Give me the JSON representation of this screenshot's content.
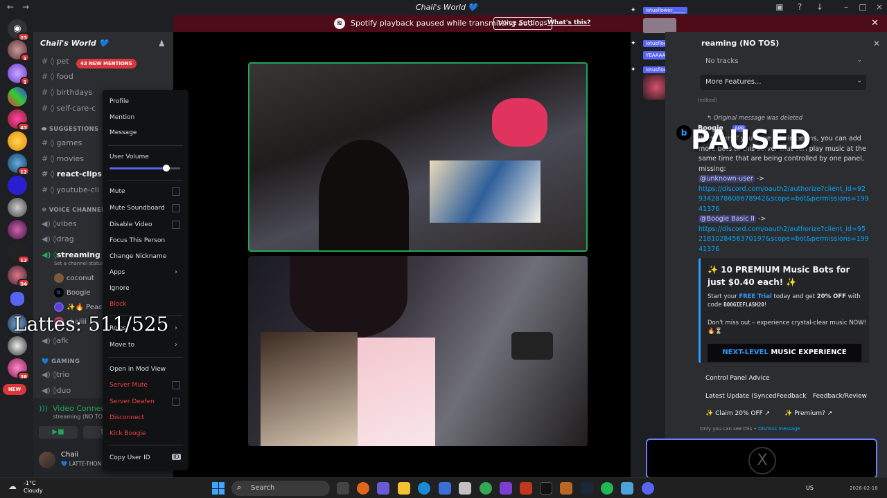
{
  "window": {
    "title": "Chaii's World 💙"
  },
  "banner": {
    "text": "Spotify playback paused while transmitting audio.",
    "button": "Voice Settings",
    "link": "What's this?"
  },
  "rail": {
    "badges": [
      "23",
      "1",
      "1",
      "43",
      "12",
      "12",
      "34",
      "36"
    ],
    "new_label": "NEW"
  },
  "sidebar": {
    "server_name": "Chaii's World 💙",
    "mentions_pill": "43 NEW MENTIONS",
    "channels_top": [
      {
        "name": "pet"
      },
      {
        "name": "food"
      },
      {
        "name": "birthdays"
      },
      {
        "name": "self-care-c"
      }
    ],
    "category_suggestions": "SUGGESTIONS",
    "channels_suggestions": [
      {
        "name": "games"
      },
      {
        "name": "movies"
      },
      {
        "name": "react-clips"
      },
      {
        "name": "youtube-cli"
      }
    ],
    "category_voice": "VOICE CHANNELS",
    "voice_channels": [
      {
        "name": "vibes"
      },
      {
        "name": "drag"
      },
      {
        "name": "streaming ("
      },
      {
        "name": "afk"
      }
    ],
    "streaming_status": "Set a channel status",
    "voice_users": [
      "coconut",
      "Boogie",
      "✨🔥 Peach",
      "chaiiii"
    ],
    "category_gaming": "GAMING",
    "gaming_channels": [
      {
        "name": "trio"
      },
      {
        "name": "duo"
      }
    ],
    "voice_connected": "Video Connected",
    "voice_sub": "streaming (NO TOS) / Chaii",
    "user_name": "Chaii",
    "user_status": "💙 LATTE-THON 💙 [ +1"
  },
  "context_menu": {
    "profile": "Profile",
    "mention": "Mention",
    "message": "Message",
    "user_volume": "User Volume",
    "user_volume_level": 0.8,
    "mute": "Mute",
    "mute_soundboard": "Mute Soundboard",
    "disable_video": "Disable Video",
    "focus": "Focus This Person",
    "change_nickname": "Change Nickname",
    "apps": "Apps",
    "ignore": "Ignore",
    "block": "Block",
    "roles": "Roles",
    "move_to": "Move to",
    "mod_view": "Open in Mod View",
    "server_mute": "Server Mute",
    "server_deafen": "Server Deafen",
    "disconnect": "Disconnect",
    "kick": "Kick Boogie",
    "copy_id": "Copy User ID",
    "id_badge": "ID"
  },
  "overlay": {
    "counter": "Lattes: 511/525",
    "paused": "PAUSED"
  },
  "activity": {
    "users": [
      "lotusflower_____",
      "lotusflower_____",
      "lotusflower_____"
    ],
    "reaction_text": "YEAAAA I LIKE THAT"
  },
  "chat": {
    "panel_title": "reaming (NO TOS)",
    "tracks_dropdown": "No tracks",
    "features_dropdown": "More Features...",
    "edited": "(edited)",
    "deleted_note": "Original message was deleted",
    "bot_name": "Boogie",
    "bot_tag": "APP",
    "bot_avatar_letter": "b",
    "message_intro": "Reminder: If you have admin perms, you can add more bots to this server that can play music at the same time that are being controlled by one panel, missing:",
    "mention1": "@unknown-user",
    "link1": "https://discord.com/oauth2/authorize?client_id=929342878608678942&scope=bot&permissions=19941376",
    "mention2": "@Boogie Basic II",
    "link2": "https://discord.com/oauth2/authorize?client_id=952181028456370197&scope=bot&permissions=19941376",
    "arrow": "->",
    "embed_title": "✨ 10 PREMIUM Music Bots for just $0.40 each! ✨",
    "embed_body_pre": "Start your",
    "embed_free": "FREE Trial",
    "embed_body_mid": "today and get",
    "embed_off": "20% OFF",
    "embed_body_post": "with code",
    "embed_code": "BOOGIEFLASH20",
    "embed_body2": "Don't miss out – experience crystal-clear music NOW! 🔥⏳",
    "embed_banner_a": "NEXT-LEVEL",
    "embed_banner_b": "MUSIC EXPERIENCE",
    "btn_control": "Control Panel Advice",
    "btn_update": "Latest Update (SyncedFeedback)",
    "btn_feedback": "Feedback/Review",
    "btn_claim": "✨ Claim 20% OFF ↗",
    "btn_premium": "✨ Premium? ↗",
    "only_you": "Only you can see this •",
    "dismiss": "Dismiss message"
  },
  "taskbar": {
    "temp": "-1°C",
    "weather": "Cloudy",
    "search": "Search",
    "lang": "US",
    "date": "2026-02-18"
  }
}
